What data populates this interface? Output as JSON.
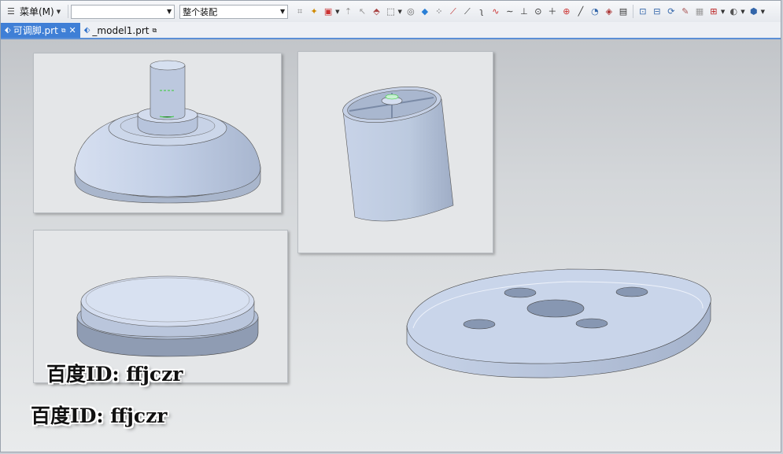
{
  "toolbar": {
    "menu_label": "菜单(M)",
    "filter_combo_value": "",
    "assembly_combo_value": "整个装配",
    "icons": [
      "snap-icon",
      "select-icon",
      "filter-icon",
      "point-icon",
      "rect-select-icon",
      "sphere-icon",
      "cube-icon",
      "curve-icon",
      "line-icon",
      "arc-icon",
      "spline-icon",
      "wave-icon",
      "plus-icon",
      "circle-icon",
      "crosshair-icon",
      "diagonal-icon",
      "view-icon",
      "layer-icon",
      "zoom-icon",
      "rotate-icon",
      "render-icon",
      "grid-icon",
      "shade-icon",
      "box-icon"
    ]
  },
  "tabs": [
    {
      "label": "可调脚.prt",
      "active": true
    },
    {
      "label": "_model1.prt",
      "active": false
    }
  ],
  "watermarks": [
    {
      "text": "百度ID: ffjczr"
    },
    {
      "text": "百度ID: ffjczr"
    }
  ],
  "colors": {
    "part_fill": "#c6d2e6",
    "part_shadow": "#9eabc2",
    "tab_active": "#3f7fd6"
  }
}
